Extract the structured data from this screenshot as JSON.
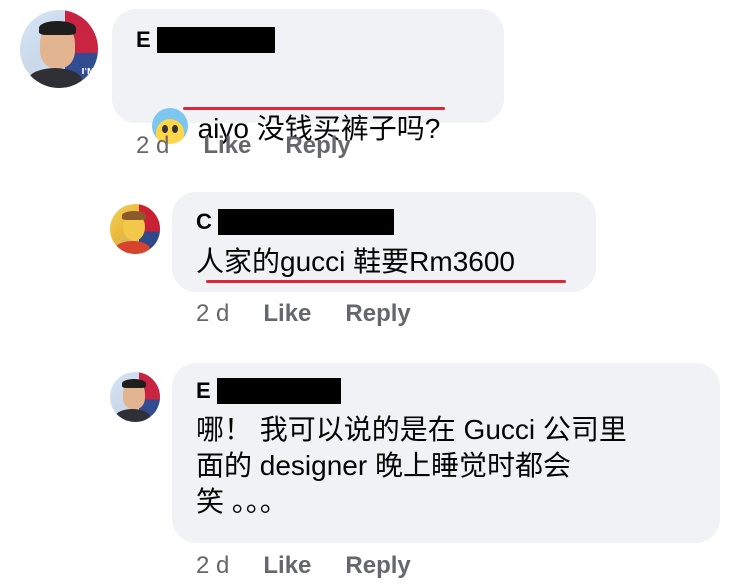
{
  "comments": [
    {
      "author_initial": "E",
      "text": "aiyo 没钱买裤子吗?",
      "emoji": "anxious-face-with-sweat",
      "time": "2 d",
      "like_label": "Like",
      "reply_label": "Reply"
    },
    {
      "author_initial": "C",
      "text": "人家的gucci 鞋要Rm3600",
      "time": "2 d",
      "like_label": "Like",
      "reply_label": "Reply"
    },
    {
      "author_initial": "E",
      "text": "哪！ 我可以说的是在 Gucci 公司里\n面的 designer 晚上睡觉时都会\n笑 。。。",
      "time": "2 d",
      "like_label": "Like",
      "reply_label": "Reply"
    }
  ],
  "colors": {
    "bubble": "#f0f2f5",
    "meta_text": "#65676b",
    "underline": "#e0243a",
    "redaction": "#000000"
  }
}
